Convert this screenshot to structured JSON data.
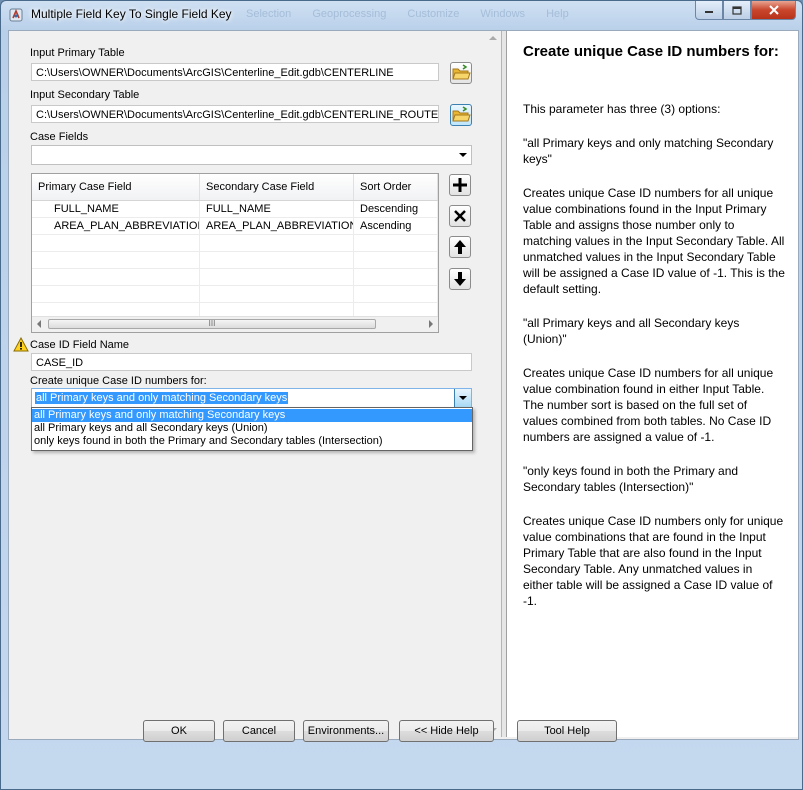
{
  "window": {
    "title": "Multiple Field Key To Single Field Key",
    "background_menu": [
      "Selection",
      "Geoprocessing",
      "Customize",
      "Windows",
      "Help"
    ]
  },
  "form": {
    "primary_table_label": "Input Primary Table",
    "primary_table_value": "C:\\Users\\OWNER\\Documents\\ArcGIS\\Centerline_Edit.gdb\\CENTERLINE",
    "secondary_table_label": "Input Secondary Table",
    "secondary_table_value": "C:\\Users\\OWNER\\Documents\\ArcGIS\\Centerline_Edit.gdb\\CENTERLINE_ROUTES",
    "case_fields_label": "Case Fields",
    "case_fields_value": "",
    "grid": {
      "headers": [
        "Primary Case Field",
        "Secondary Case Field",
        "Sort Order"
      ],
      "rows": [
        [
          "FULL_NAME",
          "FULL_NAME",
          "Descending"
        ],
        [
          "AREA_PLAN_ABBREVIATION",
          "AREA_PLAN_ABBREVIATION",
          "Ascending"
        ]
      ],
      "scroll_grip": "III"
    },
    "case_id_label": "Case ID Field Name",
    "case_id_value": "CASE_ID",
    "create_label": "Create unique Case ID numbers for:",
    "create_selected": "all Primary keys and only matching Secondary keys",
    "create_options": [
      "all Primary keys and only matching Secondary keys",
      "all Primary keys and all Secondary keys (Union)",
      "only keys found in both the Primary and Secondary tables (Intersection)"
    ]
  },
  "buttons": {
    "ok": "OK",
    "cancel": "Cancel",
    "environments": "Environments...",
    "hide_help": "<< Hide Help",
    "tool_help": "Tool Help"
  },
  "help": {
    "title": "Create unique Case ID numbers for:",
    "paragraphs": [
      "This parameter has three (3) options:",
      "\"all Primary keys and only matching Secondary keys\"",
      "Creates unique Case ID numbers for all unique value combinations found in the Input Primary Table and assigns those number only to matching values in the Input Secondary Table. All unmatched values in the Input Secondary Table will be assigned a Case ID value of -1. This is the default setting.",
      "\"all Primary keys and all Secondary keys (Union)\"",
      "Creates unique Case ID numbers for all unique value combination found in either Input Table. The number sort is based on the full set of values combined from both tables. No Case ID numbers are assigned a value of -1.",
      "\"only keys found in both the Primary and Secondary tables (Intersection)\"",
      "Creates unique Case ID numbers only for unique value combinations that are found in the Input Primary Table that are also found in the Input Secondary Table. Any unmatched values in either table will be assigned a Case ID value of -1."
    ]
  },
  "colors": {
    "selection": "#3399ff",
    "window_frame": "#b9d0ea",
    "close_button": "#c9452c"
  },
  "icons": {
    "app": "geoprocessing-tool-icon",
    "browse": "folder-open-icon",
    "add": "plus-icon",
    "remove": "x-icon",
    "move_up": "arrow-up-icon",
    "move_down": "arrow-down-icon",
    "warning": "warning-icon"
  }
}
